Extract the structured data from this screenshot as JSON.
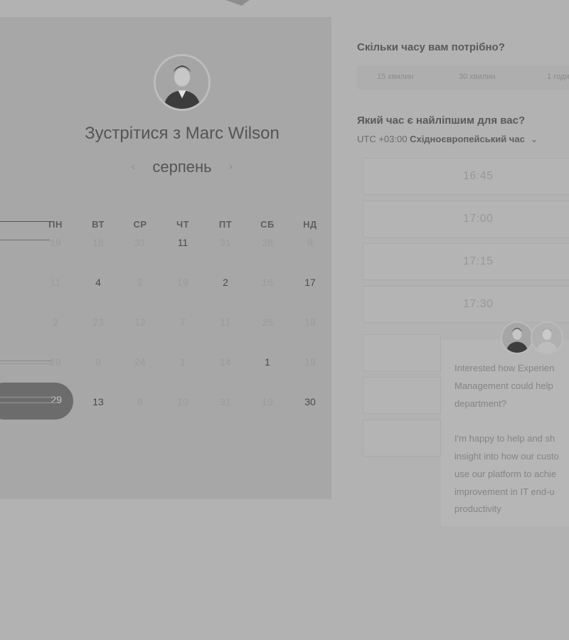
{
  "calendar": {
    "title": "Зустрітися з Marc Wilson",
    "month": "серпень",
    "weekdays": [
      "ПН",
      "ВТ",
      "СР",
      "ЧТ",
      "ПТ",
      "СБ",
      "НД"
    ],
    "weeks": [
      [
        "19",
        "18",
        "31",
        "11",
        "31",
        "28",
        "8"
      ],
      [
        "11",
        "4",
        "2",
        "19",
        "2",
        "16",
        "17"
      ],
      [
        "2",
        "23",
        "12",
        "7",
        "11",
        "25",
        "18"
      ],
      [
        "29",
        "9",
        "24",
        "1",
        "14",
        "1",
        "18"
      ],
      [
        "29",
        "13",
        "8",
        "10",
        "31",
        "19",
        "30"
      ]
    ],
    "available": [
      [
        false,
        false,
        false,
        true,
        false,
        false,
        false
      ],
      [
        false,
        true,
        false,
        false,
        true,
        false,
        true
      ],
      [
        false,
        false,
        false,
        false,
        false,
        false,
        false
      ],
      [
        false,
        false,
        false,
        false,
        false,
        true,
        false
      ],
      [
        false,
        true,
        false,
        false,
        false,
        false,
        true
      ]
    ],
    "selected_day": "29"
  },
  "scheduler": {
    "duration_heading": "Скільки часу вам потрібно?",
    "durations": [
      "15 хвилин",
      "30 хвилин",
      "1 годи"
    ],
    "time_heading": "Який час є найліпшим для вас?",
    "timezone_offset": "UTC +03:00",
    "timezone_name": "Східноєвропейський час",
    "timezone_caret": "⌄",
    "slots": [
      "16:45",
      "17:00",
      "17:15",
      "17:30"
    ]
  },
  "chat": {
    "lines": [
      "Interested how Experien",
      "Management could help",
      "department?",
      "",
      "I'm happy to help and sh",
      "insight into how our custo",
      "use our platform to achie",
      "improvement in IT end-u",
      "productivity"
    ]
  },
  "icons": {
    "prev": "‹",
    "next": "›"
  }
}
